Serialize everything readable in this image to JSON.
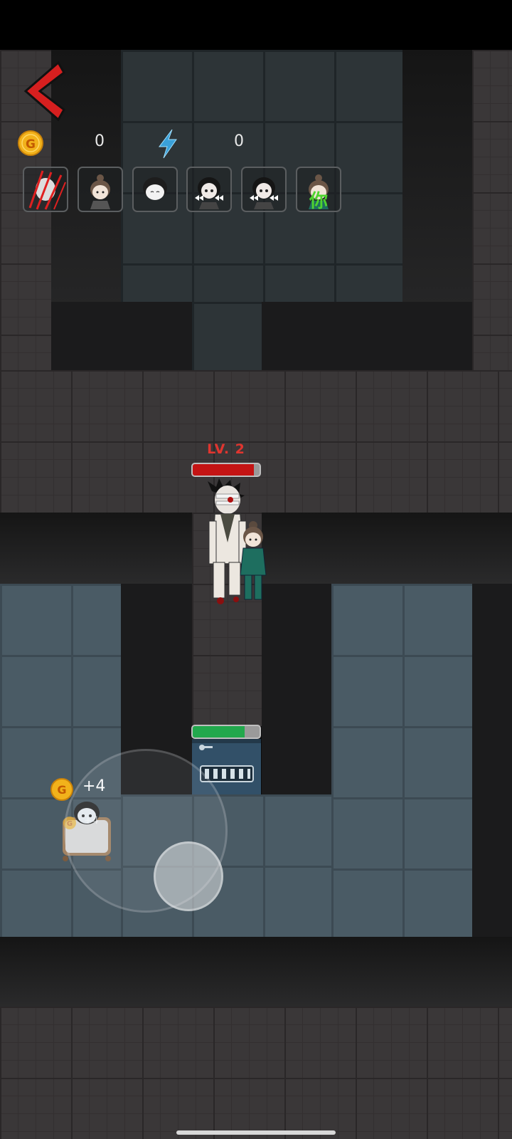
{
  "hud": {
    "gold_value": "0",
    "energy_value": "0",
    "colors": {
      "back_arrow": "#d61f1f",
      "gold": "#f2b21b",
      "energy": "#3aa0d8",
      "level_text": "#e0352f",
      "enemy_hp": "#c41414",
      "door_hp": "#22a84d"
    }
  },
  "portraits": [
    {
      "id": "ghost-claw",
      "icon": "claw-slash-icon",
      "label": ""
    },
    {
      "id": "girl-bun-1",
      "icon": "girl-bun-face-icon",
      "label": ""
    },
    {
      "id": "boy-dark-hair",
      "icon": "boy-face-icon",
      "label": ""
    },
    {
      "id": "girl-twin-bows-1",
      "icon": "girl-bows-face-icon",
      "label": ""
    },
    {
      "id": "girl-twin-bows-2",
      "icon": "girl-bows-face-icon",
      "label": ""
    },
    {
      "id": "player-you",
      "icon": "girl-bun-face-icon",
      "label": "你"
    }
  ],
  "enemy": {
    "level_label": "LV. 2",
    "hp_fraction": 0.92
  },
  "door": {
    "hp_fraction": 0.78
  },
  "bed_reward": {
    "big_amount": "+4",
    "small_amount": "+4"
  }
}
